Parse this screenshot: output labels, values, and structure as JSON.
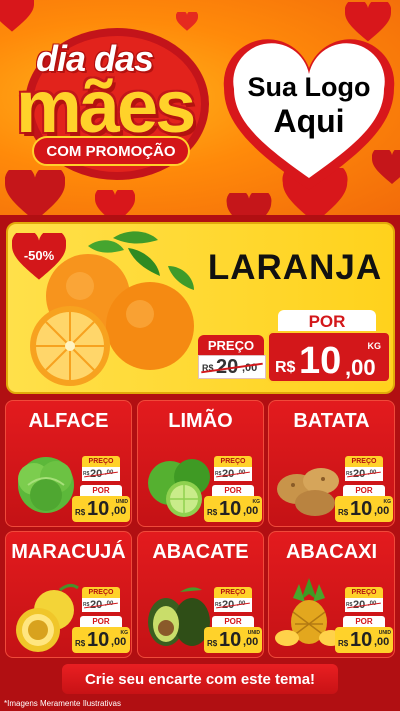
{
  "header": {
    "title_line1": "dia das",
    "title_line2": "mães",
    "promo_label": "COM PROMOÇÃO",
    "logo_line1": "Sua Logo",
    "logo_line2": "Aqui"
  },
  "featured": {
    "discount": "-50%",
    "name": "LARANJA",
    "preco_label": "PREÇO",
    "old_currency": "R$",
    "old_int": "20",
    "old_dec": ",00",
    "por_label": "POR",
    "currency": "R$",
    "price_int": "10",
    "price_dec": ",00",
    "unit": "KG"
  },
  "products": [
    {
      "name": "ALFACE",
      "preco_label": "PREÇO",
      "old_currency": "R$",
      "old_int": "20",
      "old_dec": ",00",
      "por_label": "POR",
      "currency": "R$",
      "price_int": "10",
      "price_dec": ",00",
      "unit": "UNID"
    },
    {
      "name": "LIMÃO",
      "preco_label": "PREÇO",
      "old_currency": "R$",
      "old_int": "20",
      "old_dec": ",00",
      "por_label": "POR",
      "currency": "R$",
      "price_int": "10",
      "price_dec": ",00",
      "unit": "KG"
    },
    {
      "name": "BATATA",
      "preco_label": "PREÇO",
      "old_currency": "R$",
      "old_int": "20",
      "old_dec": ",00",
      "por_label": "POR",
      "currency": "R$",
      "price_int": "10",
      "price_dec": ",00",
      "unit": "KG"
    },
    {
      "name": "MARACUJÁ",
      "preco_label": "PREÇO",
      "old_currency": "R$",
      "old_int": "20",
      "old_dec": ",00",
      "por_label": "POR",
      "currency": "R$",
      "price_int": "10",
      "price_dec": ",00",
      "unit": "KG"
    },
    {
      "name": "ABACATE",
      "preco_label": "PREÇO",
      "old_currency": "R$",
      "old_int": "20",
      "old_dec": ",00",
      "por_label": "POR",
      "currency": "R$",
      "price_int": "10",
      "price_dec": ",00",
      "unit": "UNID"
    },
    {
      "name": "ABACAXI",
      "preco_label": "PREÇO",
      "old_currency": "R$",
      "old_int": "20",
      "old_dec": ",00",
      "por_label": "POR",
      "currency": "R$",
      "price_int": "10",
      "price_dec": ",00",
      "unit": "UNID"
    }
  ],
  "footer": {
    "cta": "Crie seu encarte com este tema!",
    "disclaimer": "*Imagens Meramente Ilustrativas"
  }
}
